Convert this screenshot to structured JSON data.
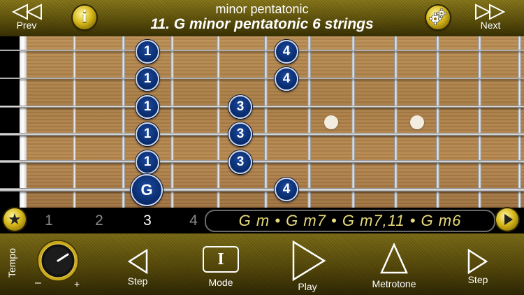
{
  "header": {
    "prev_label": "Prev",
    "next_label": "Next",
    "info_icon": "i",
    "subtitle": "minor pentatonic",
    "title": "11. G minor pentatonic 6 strings"
  },
  "fretboard": {
    "notes": [
      {
        "label": "1"
      },
      {
        "label": "4"
      },
      {
        "label": "1"
      },
      {
        "label": "4"
      },
      {
        "label": "1"
      },
      {
        "label": "3"
      },
      {
        "label": "1"
      },
      {
        "label": "3"
      },
      {
        "label": "1"
      },
      {
        "label": "3"
      },
      {
        "label": "G"
      },
      {
        "label": "4"
      }
    ]
  },
  "fretbar": {
    "fav_icon": "★",
    "fret_numbers": [
      "1",
      "2",
      "3",
      "4"
    ],
    "active_fret": "3",
    "chords": "G m • G m7 • G m7,11 • G m6"
  },
  "toolbar": {
    "tempo_label": "Tempo",
    "tempo_minus": "–",
    "tempo_plus": "+",
    "step_back_label": "Step",
    "mode_label": "Mode",
    "mode_icon": "I",
    "play_label": "Play",
    "metrotone_label": "Metrotone",
    "step_forward_label": "Step"
  },
  "colors": {
    "gold_accent": "#d6b81a",
    "note_fill": "#0a3178",
    "chord_text": "#e8da7a"
  }
}
